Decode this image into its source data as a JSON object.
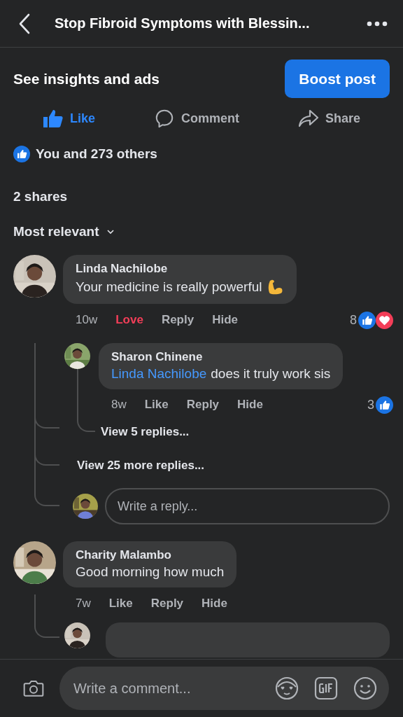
{
  "header": {
    "title": "Stop Fibroid Symptoms with Blessin..."
  },
  "insights": {
    "label": "See insights and ads",
    "button": "Boost post"
  },
  "actions": [
    {
      "kind": "like",
      "label": "Like",
      "selected": true
    },
    {
      "kind": "comment",
      "label": "Comment",
      "selected": false
    },
    {
      "kind": "share",
      "label": "Share",
      "selected": false
    }
  ],
  "reactions_summary": "You and 273 others",
  "shares": "2 shares",
  "sort": "Most relevant",
  "comments": [
    {
      "author": "Linda Nachilobe",
      "text": "Your medicine is really powerful",
      "emoji": {
        "kind": "flexed-arm"
      },
      "time": "10w",
      "reaction": {
        "kind": "love",
        "label": "Love",
        "selected": true
      },
      "reply_label": "Reply",
      "hide_label": "Hide",
      "count": "8",
      "reaction_icons": [
        {
          "kind": "like"
        },
        {
          "kind": "love"
        }
      ],
      "replies": [
        {
          "kind": "reply",
          "author": "Sharon Chinene",
          "mention": "Linda Nachilobe",
          "text": "does it truly work sis",
          "time": "8w",
          "reaction": {
            "label": "Like",
            "selected": false
          },
          "reply_label": "Reply",
          "hide_label": "Hide",
          "count": "3",
          "reaction_icons": [
            {
              "kind": "like"
            }
          ],
          "view_replies": "View 5 replies..."
        }
      ],
      "more_replies": "View 25 more replies...",
      "reply_placeholder": "Write a reply..."
    },
    {
      "author": "Charity Malambo",
      "text": "Good morning how much",
      "time": "7w",
      "reaction": {
        "label": "Like",
        "selected": false
      },
      "reply_label": "Reply",
      "hide_label": "Hide",
      "replies": [
        {
          "kind": "partial"
        }
      ]
    }
  ],
  "composer": {
    "placeholder": "Write a comment..."
  }
}
